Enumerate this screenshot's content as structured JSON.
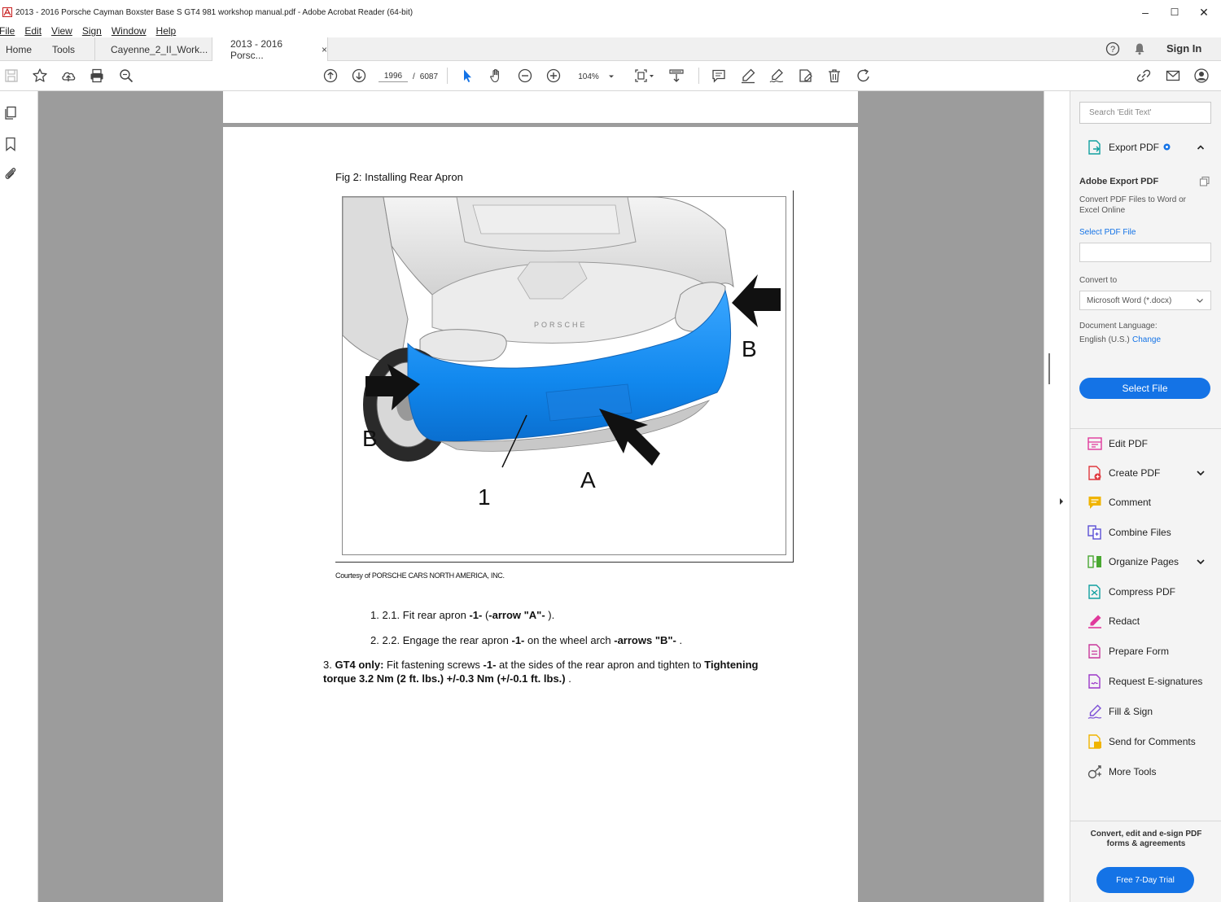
{
  "window": {
    "title": "2013 - 2016 Porsche Cayman Boxster  Base S GT4 981 workshop manual.pdf - Adobe Acrobat Reader (64-bit)",
    "minimize": "–",
    "maximize": "☐",
    "close": "✕"
  },
  "menu": [
    "File",
    "Edit",
    "View",
    "Sign",
    "Window",
    "Help"
  ],
  "tabs": {
    "home": "Home",
    "tools": "Tools",
    "doc1": "Cayenne_2_II_Work...",
    "doc2": "2013 - 2016 Porsc...",
    "close": "×",
    "sign_in": "Sign In"
  },
  "toolbar": {
    "current_page": "1996",
    "separator": "/",
    "total_pages": "6087",
    "zoom": "104%"
  },
  "document": {
    "fig_caption": "Fig 2: Installing Rear Apron",
    "credit": "Courtesy of PORSCHE CARS NORTH AMERICA, INC.",
    "labels": {
      "b_right": "B",
      "b_left": "B",
      "one": "1",
      "a": "A"
    },
    "steps": [
      {
        "num": "1. 2.1.",
        "pre": "Fit rear apron",
        "b1": "-1-",
        "mid": " (",
        "b2": "-arrow \"A\"-",
        "post": " )."
      },
      {
        "num": "2. 2.2.",
        "pre": "Engage the rear apron",
        "b1": "-1-",
        "mid": " on the wheel arch",
        "b2": "-arrows \"B\"-",
        "post": " ."
      },
      {
        "num": "3.",
        "lead": "GT4 only:",
        "pre": "Fit fastening screws",
        "b1": "-1-",
        "mid": " at the sides of the rear apron and tighten to",
        "b2": "Tightening torque 3.2 Nm (2 ft. lbs.) +/-0.3 Nm (+/-0.1 ft. lbs.)",
        "post": " ."
      }
    ]
  },
  "right_panel": {
    "search_placeholder": "Search 'Edit Text'",
    "export_title": "Export PDF",
    "card_title": "Adobe Export PDF",
    "card_desc": "Convert PDF Files to Word or Excel Online",
    "select_pdf_file": "Select PDF File",
    "convert_to_label": "Convert to",
    "convert_to_value": "Microsoft Word (*.docx)",
    "doc_language_label": "Document Language:",
    "doc_language_value": "English (U.S.)",
    "change": "Change",
    "select_file_button": "Select File",
    "tools": [
      {
        "label": "Edit PDF",
        "icon": "edit-pdf-icon",
        "color": "#e0389b"
      },
      {
        "label": "Create PDF",
        "icon": "create-pdf-icon",
        "color": "#e0383e"
      },
      {
        "label": "Comment",
        "icon": "comment-icon",
        "color": "#f0b400"
      },
      {
        "label": "Combine Files",
        "icon": "combine-files-icon",
        "color": "#5a4fd6"
      },
      {
        "label": "Organize Pages",
        "icon": "organize-pages-icon",
        "color": "#4aa832"
      },
      {
        "label": "Compress PDF",
        "icon": "compress-pdf-icon",
        "color": "#11a0a0"
      },
      {
        "label": "Redact",
        "icon": "redact-icon",
        "color": "#e0389b"
      },
      {
        "label": "Prepare Form",
        "icon": "prepare-form-icon",
        "color": "#c8379b"
      },
      {
        "label": "Request E-signatures",
        "icon": "request-esign-icon",
        "color": "#9b37c8"
      },
      {
        "label": "Fill & Sign",
        "icon": "fill-sign-icon",
        "color": "#7c4fd6"
      },
      {
        "label": "Send for Comments",
        "icon": "send-comments-icon",
        "color": "#f0b400"
      },
      {
        "label": "More Tools",
        "icon": "more-tools-icon",
        "color": "#555555"
      }
    ],
    "footer_text": "Convert, edit and e-sign PDF forms & agreements",
    "trial_button": "Free 7-Day Trial"
  }
}
